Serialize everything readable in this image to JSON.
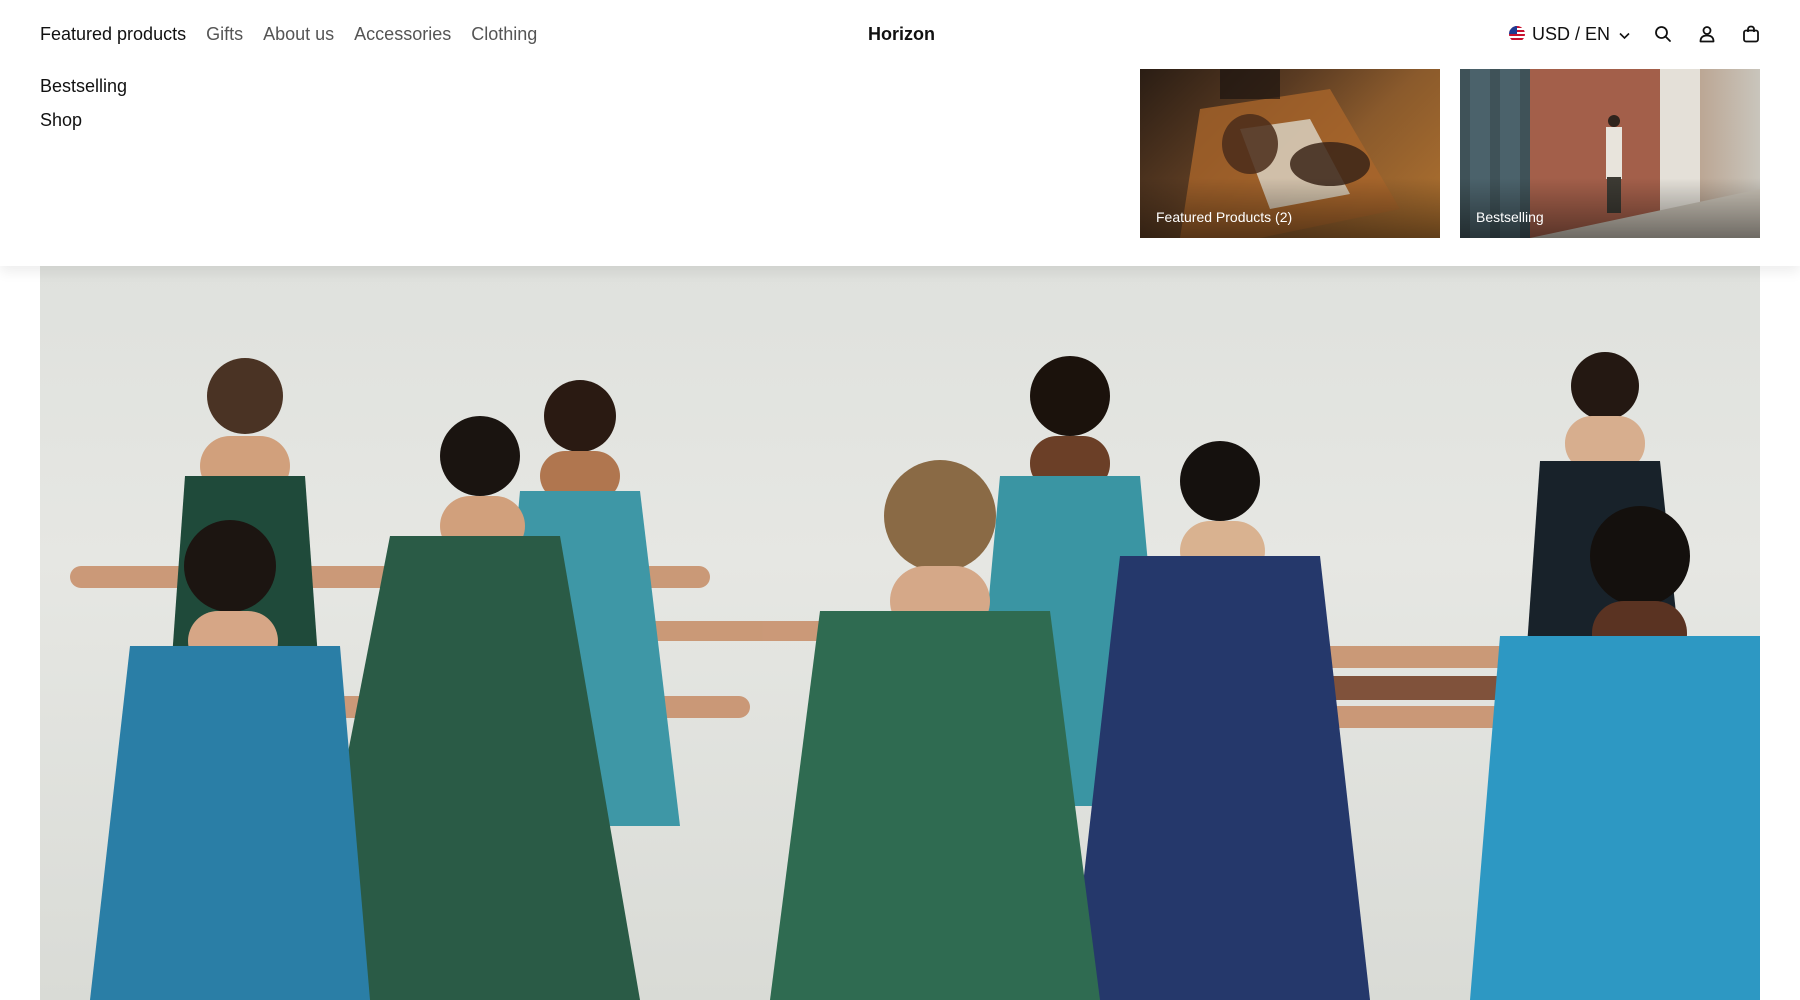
{
  "header": {
    "nav": [
      {
        "label": "Featured products",
        "active": true
      },
      {
        "label": "Gifts",
        "active": false
      },
      {
        "label": "About us",
        "active": false
      },
      {
        "label": "Accessories",
        "active": false
      },
      {
        "label": "Clothing",
        "active": false
      }
    ],
    "brand": "Horizon",
    "locale": "USD / EN",
    "icons": [
      "us-flag-icon",
      "chevron-down-icon",
      "search-icon",
      "account-icon",
      "cart-icon"
    ]
  },
  "submenu": {
    "items": [
      "Bestselling",
      "Shop"
    ]
  },
  "menu_cards": [
    {
      "caption": "Featured Products (2)"
    },
    {
      "caption": "Bestselling"
    }
  ],
  "hero": {
    "image": "hero-yoga-group-image"
  },
  "colors": {
    "text": "#111111",
    "muted_text": "#555555",
    "background": "#ffffff"
  }
}
